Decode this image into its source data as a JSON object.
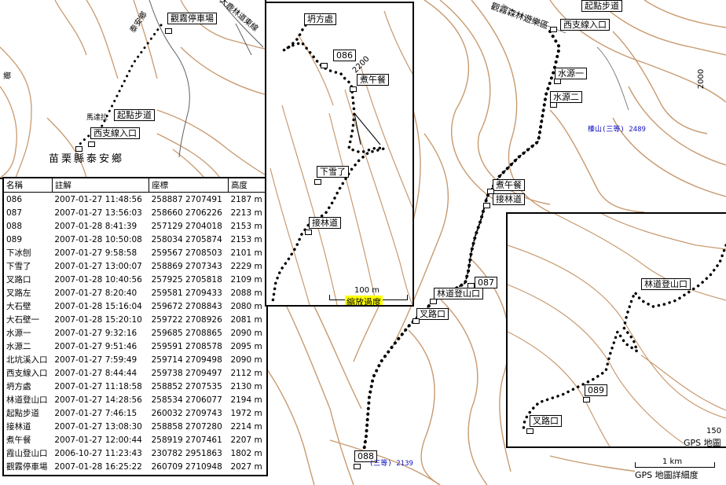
{
  "background_map": {
    "labels": {
      "road_1": "觀霧森林遊樂區",
      "start_trail": "起點步道",
      "west_branch_entrance": "西支線入口",
      "water_source_1": "水源一",
      "water_source_2": "水源二",
      "forest_road_trailhead": "林道登山口",
      "fork_road": "叉路口",
      "jie_lin_dao": "接林道",
      "zhu_wu_can": "煮午餐",
      "kan_fang_chu": "坍方處",
      "waypoint_087": "087",
      "waypoint_088": "088",
      "peak_label": "榛山(三等) 2489",
      "bottom_peak": "(三等) 2139",
      "contour_2000": "2000",
      "scale_1km": "1 km",
      "scale_caption": "GPS 地圖詳細度"
    }
  },
  "top_left_map": {
    "labels": {
      "guanwu_parking": "觀霧停車場",
      "start_trail": "起點步道",
      "west_branch_entrance": "西支線入口",
      "county": "苗栗縣泰安鄉",
      "road_text": "大鹿林道東線",
      "road_text_2": "泰安鄉",
      "road_text_3": "馬達拉",
      "unknown_mark": "鄉"
    }
  },
  "zoom_panel_1": {
    "labels": {
      "kan_fang_chu": "坍方處",
      "waypoint_086": "086",
      "zhu_wu_can": "煮午餐",
      "xia_xue_le": "下雪了",
      "jie_lin_dao": "接林道",
      "contour_2200": "2200"
    },
    "scale_label": "100 m",
    "scale_caption": "縮放過度"
  },
  "zoom_panel_2": {
    "labels": {
      "forest_road_trailhead": "林道登山口",
      "waypoint_089": "089",
      "fork_road": "叉路口"
    },
    "scale_label": "150",
    "scale_caption": "GPS 地圖"
  },
  "waypoint_table": {
    "headers": [
      "名稱",
      "註解",
      "座標",
      "高度"
    ],
    "rows": [
      [
        "086",
        "2007-01-27 11:48:56",
        "258887 2707491",
        "2187 m"
      ],
      [
        "087",
        "2007-01-27 13:56:03",
        "258660 2706226",
        "2213 m"
      ],
      [
        "088",
        "2007-01-28 8:41:39",
        "257129 2704018",
        "2153 m"
      ],
      [
        "089",
        "2007-01-28 10:50:08",
        "258034 2705874",
        "2153 m"
      ],
      [
        "下冰刨",
        "2007-01-27 9:58:58",
        "259567 2708503",
        "2101 m"
      ],
      [
        "下雪了",
        "2007-01-27 13:00:07",
        "258869 2707343",
        "2229 m"
      ],
      [
        "叉路口",
        "2007-01-28 10:40:56",
        "257925 2705818",
        "2109 m"
      ],
      [
        "叉路左",
        "2007-01-27 8:20:40",
        "259581 2709433",
        "2088 m"
      ],
      [
        "大石壁",
        "2007-01-28 15:16:04",
        "259672 2708843",
        "2080 m"
      ],
      [
        "大石壁一",
        "2007-01-28 15:20:10",
        "259722 2708926",
        "2081 m"
      ],
      [
        "水源一",
        "2007-01-27 9:32:16",
        "259685 2708865",
        "2090 m"
      ],
      [
        "水源二",
        "2007-01-27 9:51:46",
        "259591 2708578",
        "2095 m"
      ],
      [
        "北坑溪入口",
        "2007-01-27 7:59:49",
        "259714 2709498",
        "2090 m"
      ],
      [
        "西支線入口",
        "2007-01-27 8:44:44",
        "259738 2709497",
        "2112 m"
      ],
      [
        "坍方處",
        "2007-01-27 11:18:58",
        "258852 2707535",
        "2130 m"
      ],
      [
        "林道登山口",
        "2007-01-27 14:28:56",
        "258534 2706077",
        "2194 m"
      ],
      [
        "起點步道",
        "2007-01-27 7:46:15",
        "260032 2709743",
        "1972 m"
      ],
      [
        "接林道",
        "2007-01-27 13:08:30",
        "258858 2707280",
        "2214 m"
      ],
      [
        "煮午餐",
        "2007-01-27 12:00:44",
        "258919 2707461",
        "2207 m"
      ],
      [
        "霞山登山口",
        "2006-10-27 11:23:43",
        "230782 2951863",
        "1802 m"
      ],
      [
        "觀霧停車場",
        "2007-01-28 16:25:22",
        "260709 2710948",
        "2027 m"
      ]
    ]
  },
  "colors": {
    "contour": "#c89a70",
    "track": "#000000",
    "peak_text": "#1010c0",
    "scale_highlight": "#ffff00"
  }
}
